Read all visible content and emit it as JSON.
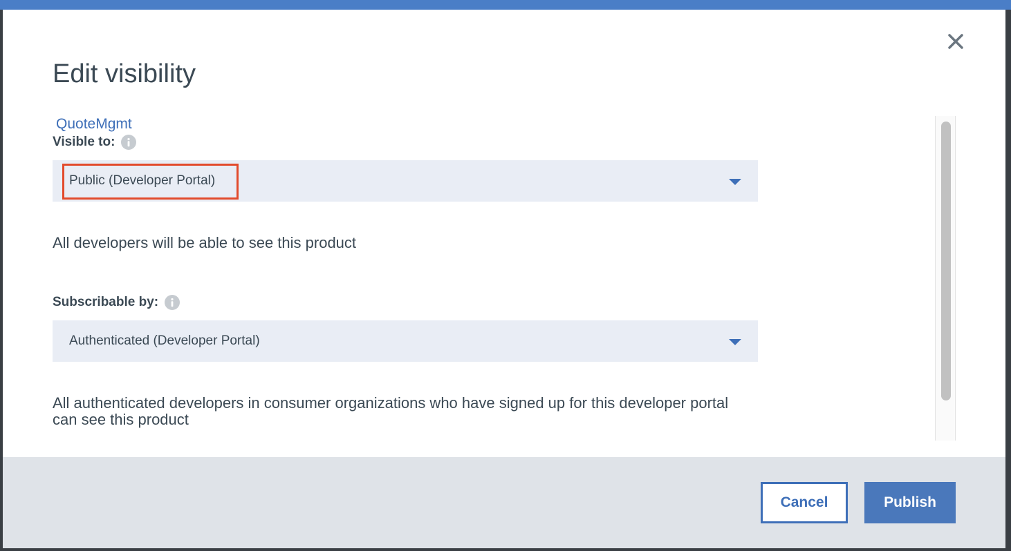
{
  "dialog": {
    "title": "Edit visibility",
    "close_icon": "close-icon"
  },
  "product": {
    "name": "QuoteMgmt"
  },
  "visible_to": {
    "label": "Visible to:",
    "info_icon": "info-icon",
    "selected": "Public (Developer Portal)",
    "caret_icon": "chevron-down-icon",
    "help": "All developers will be able to see this product",
    "highlight_color": "#e24a2b"
  },
  "subscribable_by": {
    "label": "Subscribable by:",
    "info_icon": "info-icon",
    "selected": "Authenticated (Developer Portal)",
    "caret_icon": "chevron-down-icon",
    "help": "All authenticated developers in consumer organizations who have signed up for this developer portal can see this product"
  },
  "footer": {
    "cancel_label": "Cancel",
    "publish_label": "Publish"
  },
  "colors": {
    "accent": "#3e6fb8",
    "primary_button": "#4a78bb",
    "select_bg": "#e9edf5",
    "footer_bg": "#dfe3e8",
    "text": "#3b4954"
  }
}
